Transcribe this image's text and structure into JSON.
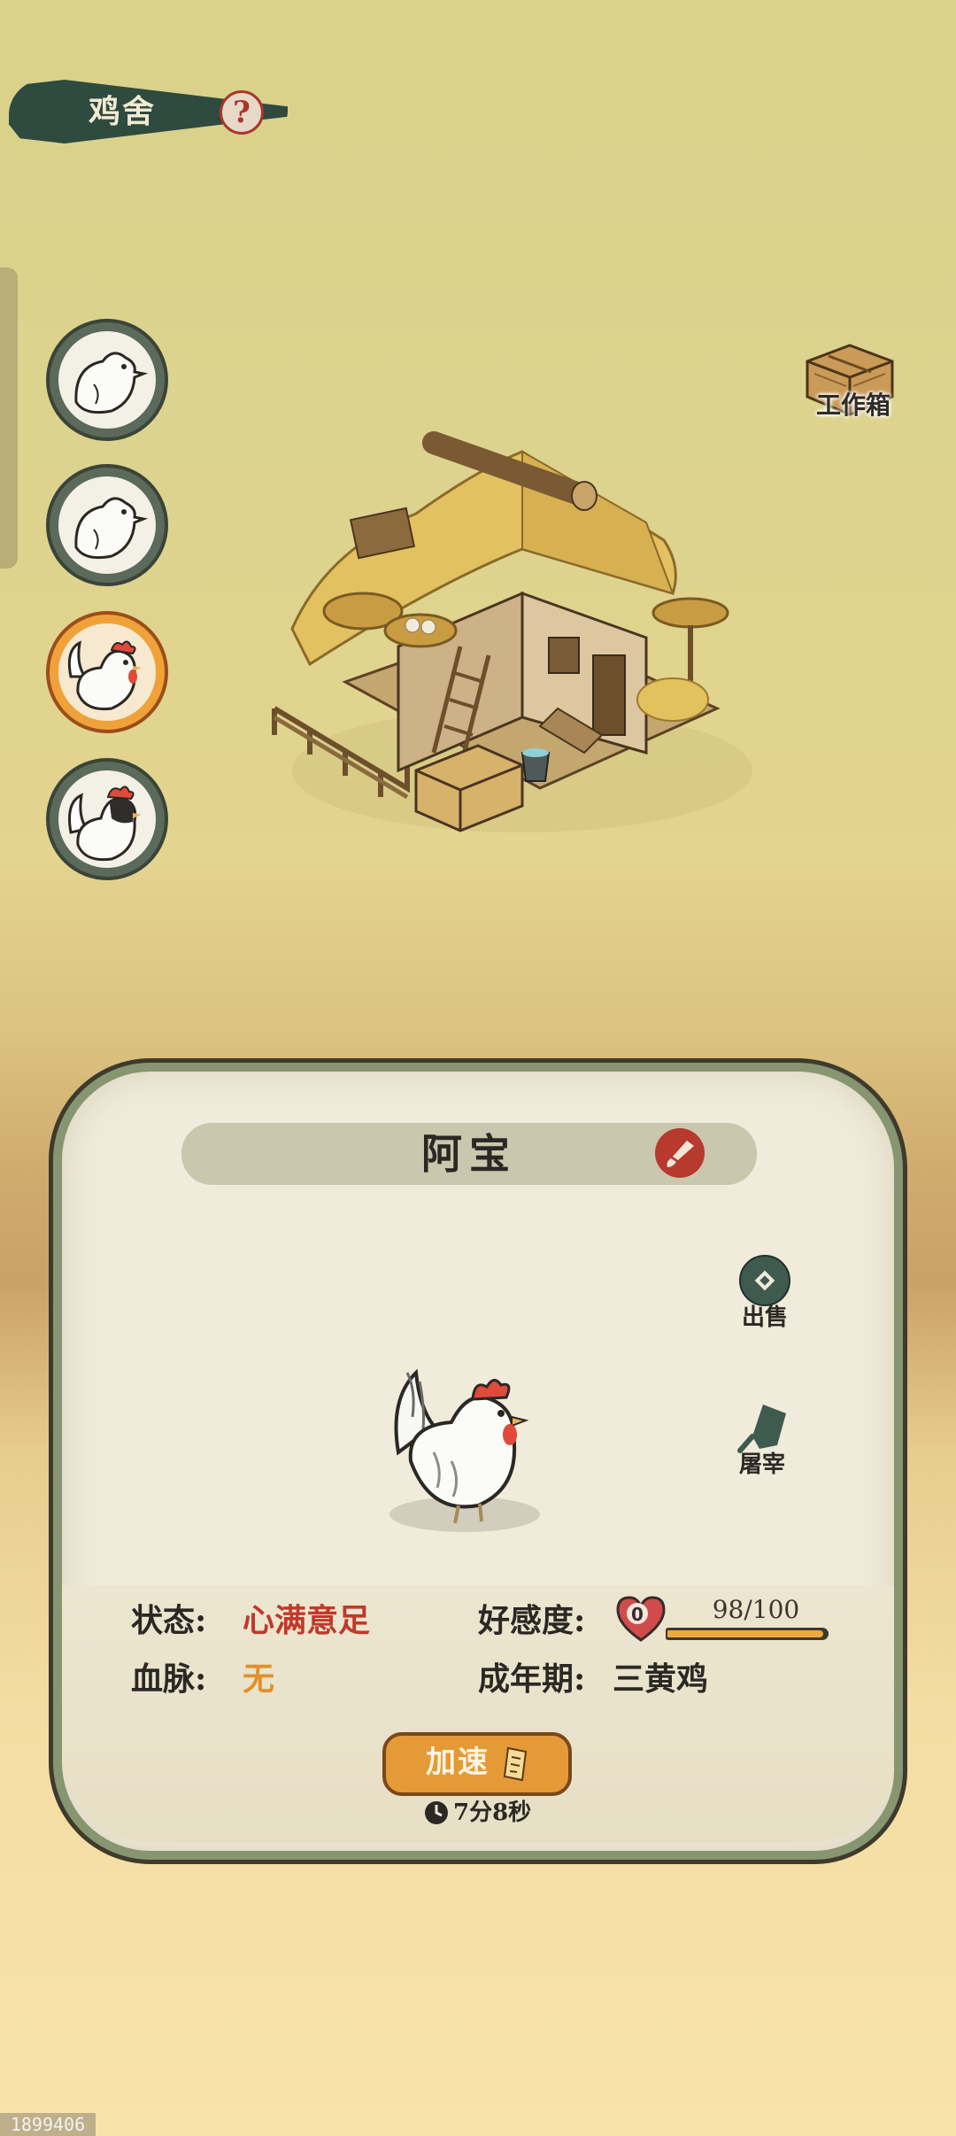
{
  "header": {
    "title": "鸡舍",
    "help_icon": "question-mark-icon"
  },
  "chicken_list": [
    {
      "name": "white-chick-avatar",
      "active": false
    },
    {
      "name": "white-chick-avatar",
      "active": false
    },
    {
      "name": "white-hen-avatar",
      "active": true
    },
    {
      "name": "black-white-hen-avatar",
      "active": false
    }
  ],
  "workbox": {
    "label": "工作箱",
    "icon": "wooden-crate-icon"
  },
  "panel": {
    "chicken_name": "阿宝",
    "rename_icon": "brush-icon",
    "actions": {
      "sell_label": "出售",
      "slaughter_label": "屠宰"
    },
    "status_label": "状态:",
    "status_value": "心满意足",
    "bloodline_label": "血脉:",
    "bloodline_value": "无",
    "affinity_label": "好感度:",
    "affinity_level": "0",
    "affinity_progress": "98/100",
    "affinity_fraction": 0.98,
    "adult_label": "成年期:",
    "adult_value": "三黄鸡",
    "speed_button_label": "加速",
    "timer": "7分8秒"
  },
  "colors": {
    "status_value": "#c0392b",
    "bloodline_value": "#e0902a",
    "accent_orange": "#e49a36",
    "title_pill": "#2f4a3f"
  },
  "watermark": "1899406"
}
